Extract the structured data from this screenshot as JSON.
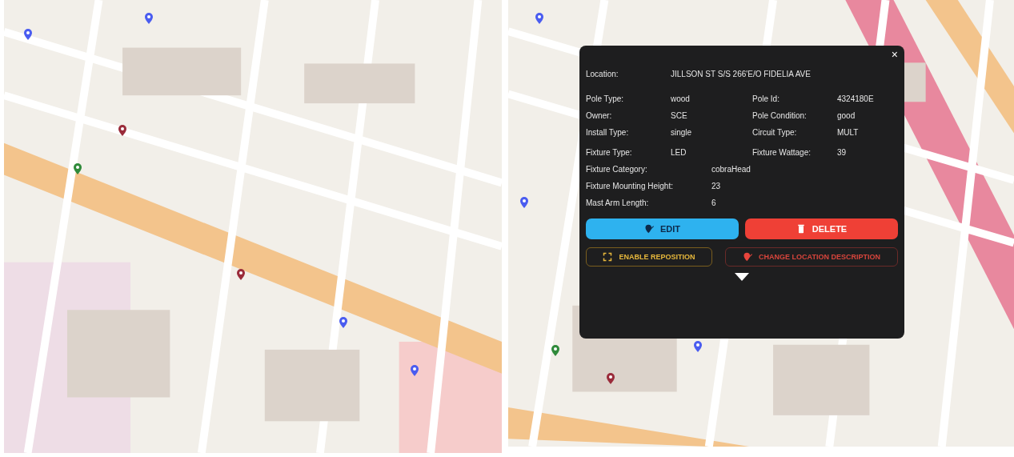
{
  "popup": {
    "close": "×",
    "location": {
      "label": "Location:",
      "value": "JILLSON ST S/S 266'E/O FIDELIA AVE"
    },
    "pole_rows": [
      [
        {
          "label": "Pole Type:",
          "value": "wood"
        },
        {
          "label": "Pole Id:",
          "value": "4324180E"
        }
      ],
      [
        {
          "label": "Owner:",
          "value": "SCE"
        },
        {
          "label": "Pole Condition:",
          "value": "good"
        }
      ],
      [
        {
          "label": "Install Type:",
          "value": "single"
        },
        {
          "label": "Circuit Type:",
          "value": "MULT"
        }
      ]
    ],
    "fixture_rows": [
      [
        {
          "label": "Fixture Type:",
          "value": "LED"
        },
        {
          "label": "Fixture Wattage:",
          "value": "39"
        }
      ]
    ],
    "detail_rows": [
      {
        "label": "Fixture Category:",
        "value": "cobraHead"
      },
      {
        "label": "Fixture Mounting Height:",
        "value": "23"
      },
      {
        "label": "Mast Arm Length:",
        "value": "6"
      }
    ],
    "main_buttons": [
      {
        "label": "EDIT",
        "kind": "edit"
      },
      {
        "label": "DELETE",
        "kind": "delete"
      }
    ],
    "secondary_buttons": [
      {
        "label": "ENABLE REPOSITION",
        "kind": "reposition"
      },
      {
        "label": "CHANGE LOCATION DESCRIPTION",
        "kind": "relocate"
      }
    ]
  }
}
